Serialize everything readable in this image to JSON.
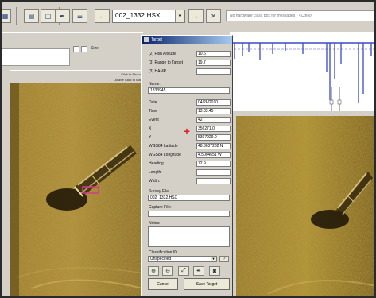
{
  "toolbar": {
    "file_combo_value": "002_1332.HSX",
    "status_text": "No hardware class box for messages - <CtrlN>"
  },
  "left_panel": {
    "hint_line1": "Click to Show F",
    "hint_line2": "Double Click to Mark",
    "size_label": "Size"
  },
  "dialog": {
    "title": "Target",
    "fish_altitude_label": "(2) Fish Altitude",
    "fish_altitude_value": "10.6",
    "range_label": "(3) Range to Target",
    "range_value": "19.7",
    "hamp_label": "(3) HAMP",
    "hamp_value": "",
    "name_label": "Name:",
    "name_value": "1333945",
    "date_label": "Date",
    "date_value": "04/26/2010",
    "time_label": "Time",
    "time_value": "13:33:45",
    "event_label": "Event",
    "event_value": "42",
    "x_label": "X",
    "x_value": "356271.0",
    "y_label": "Y",
    "y_value": "5397929.0",
    "wgs_lat_label": "WGS84 Latitude",
    "wgs_lat_value": "48.3637282 N",
    "wgs_lon_label": "WGS84 Longitude",
    "wgs_lon_value": "4.5004551 W",
    "heading_label": "Heading",
    "heading_value": "72.9",
    "length_label": "Length:",
    "length_value": "",
    "width_label": "Width:",
    "width_value": "",
    "survey_label": "Survey File:",
    "survey_value": "002_1332.HSX",
    "capture_label": "Capture File:",
    "capture_value": "",
    "notes_label": "Notes:",
    "classification_label": "Classification ID",
    "classification_value": "Unspecified",
    "help_label": "?",
    "cancel_label": "Cancel",
    "save_label": "Save Target"
  }
}
